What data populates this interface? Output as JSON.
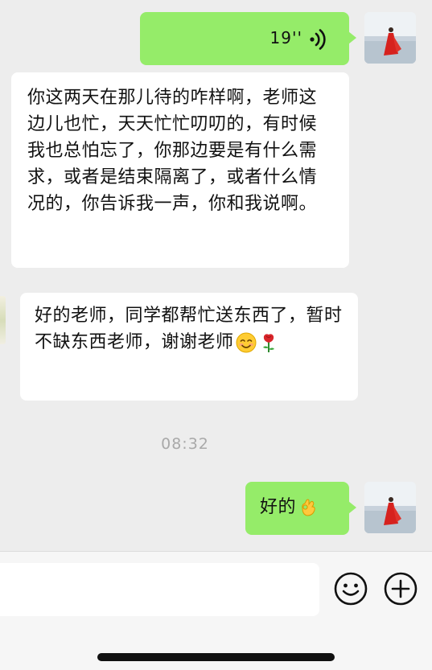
{
  "messages": [
    {
      "sender": "me",
      "type": "voice",
      "duration": "19''",
      "icon": "voice-wave-icon"
    },
    {
      "sender": "teacher",
      "type": "text",
      "text": "你这两天在那儿待的咋样啊，老师这边儿也忙，天天忙忙叨叨的，有时候我也总怕忘了，你那边要是有什么需求，或者是结束隔离了，或者什么情况的，你告诉我一声，你和我说啊。"
    },
    {
      "sender": "me_forwarded",
      "type": "text",
      "text": "好的老师，同学都帮忙送东西了，暂时不缺东西老师，谢谢老师",
      "emojis": [
        "smiling-face-emoji",
        "rose-emoji"
      ]
    },
    {
      "type": "timestamp",
      "text": "08:32"
    },
    {
      "sender": "me",
      "type": "text",
      "text": "好的",
      "emojis": [
        "ok-hand-emoji"
      ]
    }
  ],
  "input_bar": {
    "placeholder": "",
    "icons": [
      "emoji-icon",
      "plus-icon"
    ]
  },
  "colors": {
    "background": "#ededed",
    "my_bubble": "#95ec69",
    "other_bubble": "#ffffff",
    "timestamp": "#a9a9a9"
  }
}
